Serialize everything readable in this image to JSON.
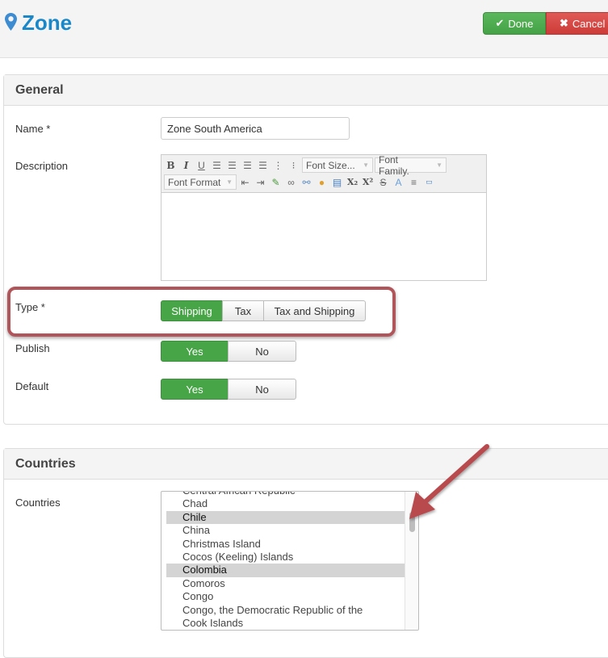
{
  "header": {
    "icon": "map-marker-icon",
    "title": "Zone",
    "done_label": "Done",
    "cancel_label": "Cancel",
    "done_color": "#4aa84a",
    "cancel_color": "#d6433f"
  },
  "general": {
    "section_title": "General",
    "name_label": "Name *",
    "name_value": "Zone South America",
    "description_label": "Description",
    "editor": {
      "row1_buttons": [
        "bold",
        "italic",
        "underline",
        "align-left",
        "align-center",
        "align-right",
        "align-justify",
        "ordered-list",
        "unordered-list"
      ],
      "font_size_placeholder": "Font Size...",
      "font_family_placeholder": "Font Family.",
      "font_format_placeholder": "Font Format",
      "row2_buttons": [
        "outdent",
        "indent",
        "edit-image",
        "insert-link",
        "unlink",
        "color-palette",
        "edit-document",
        "subscript",
        "superscript",
        "strikethrough",
        "remove-format",
        "horizontal-rule",
        "html-source"
      ],
      "content": ""
    },
    "type_label": "Type *",
    "type_options": [
      "Shipping",
      "Tax",
      "Tax and Shipping"
    ],
    "type_selected": "Shipping",
    "publish_label": "Publish",
    "publish_options": [
      "Yes",
      "No"
    ],
    "publish_selected": "Yes",
    "default_label": "Default",
    "default_options": [
      "Yes",
      "No"
    ],
    "default_selected": "Yes"
  },
  "countries": {
    "section_title": "Countries",
    "field_label": "Countries",
    "items": [
      {
        "name": "Central African Republic",
        "selected": false
      },
      {
        "name": "Chad",
        "selected": false
      },
      {
        "name": "Chile",
        "selected": true
      },
      {
        "name": "China",
        "selected": false
      },
      {
        "name": "Christmas Island",
        "selected": false
      },
      {
        "name": "Cocos (Keeling) Islands",
        "selected": false
      },
      {
        "name": "Colombia",
        "selected": true
      },
      {
        "name": "Comoros",
        "selected": false
      },
      {
        "name": "Congo",
        "selected": false
      },
      {
        "name": "Congo, the Democratic Republic of the",
        "selected": false
      },
      {
        "name": "Cook Islands",
        "selected": false
      }
    ]
  },
  "annotations": {
    "highlight_color": "#b0555a",
    "arrow_target": "countries-scrollbar"
  }
}
